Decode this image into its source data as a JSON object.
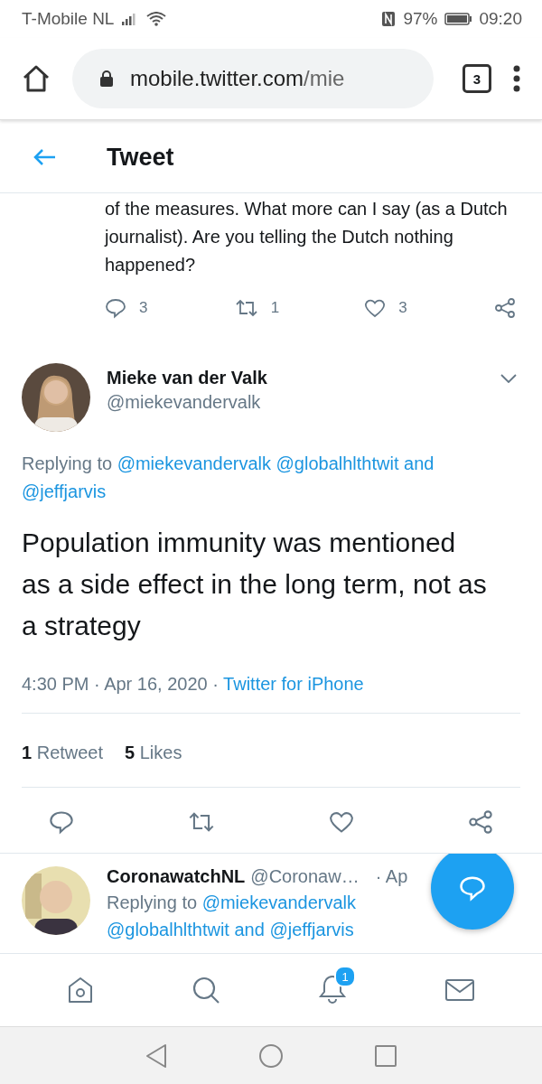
{
  "status_bar": {
    "carrier": "T-Mobile  NL",
    "battery": "97%",
    "time": "09:20"
  },
  "browser": {
    "url_host": "mobile.twitter.com",
    "url_path": "/mie",
    "tab_count": "3"
  },
  "header": {
    "title": "Tweet"
  },
  "previous_tweet": {
    "text": "of the measures. What more can I say (as a Dutch journalist). Are you telling the Dutch nothing happened?",
    "replies": "3",
    "retweets": "1",
    "likes": "3"
  },
  "tweet": {
    "name": "Mieke van der Valk",
    "handle": "@miekevandervalk",
    "replying_label": "Replying to",
    "replying_to": [
      "@miekevandervalk",
      "@globalhlthtwit"
    ],
    "replying_and": "and",
    "replying_last": "@jeffjarvis",
    "text": "Population immunity was mentioned as a side effect in the long term, not as a strategy",
    "time": "4:30 PM · Apr 16, 2020",
    "separator": "·",
    "source": "Twitter for iPhone",
    "retweet_count": "1",
    "retweet_label": "Retweet",
    "like_count": "5",
    "like_label": "Likes"
  },
  "reply": {
    "name": "CoronawatchNL",
    "handle": "@Coronaw…",
    "date": "· Ap",
    "replying_label": "Replying to",
    "replying_to": [
      "@miekevandervalk",
      "@globalhlthtwit"
    ],
    "replying_and": "and",
    "replying_last": "@jeffjarvis"
  },
  "bottom_nav": {
    "notification_badge": "1"
  }
}
